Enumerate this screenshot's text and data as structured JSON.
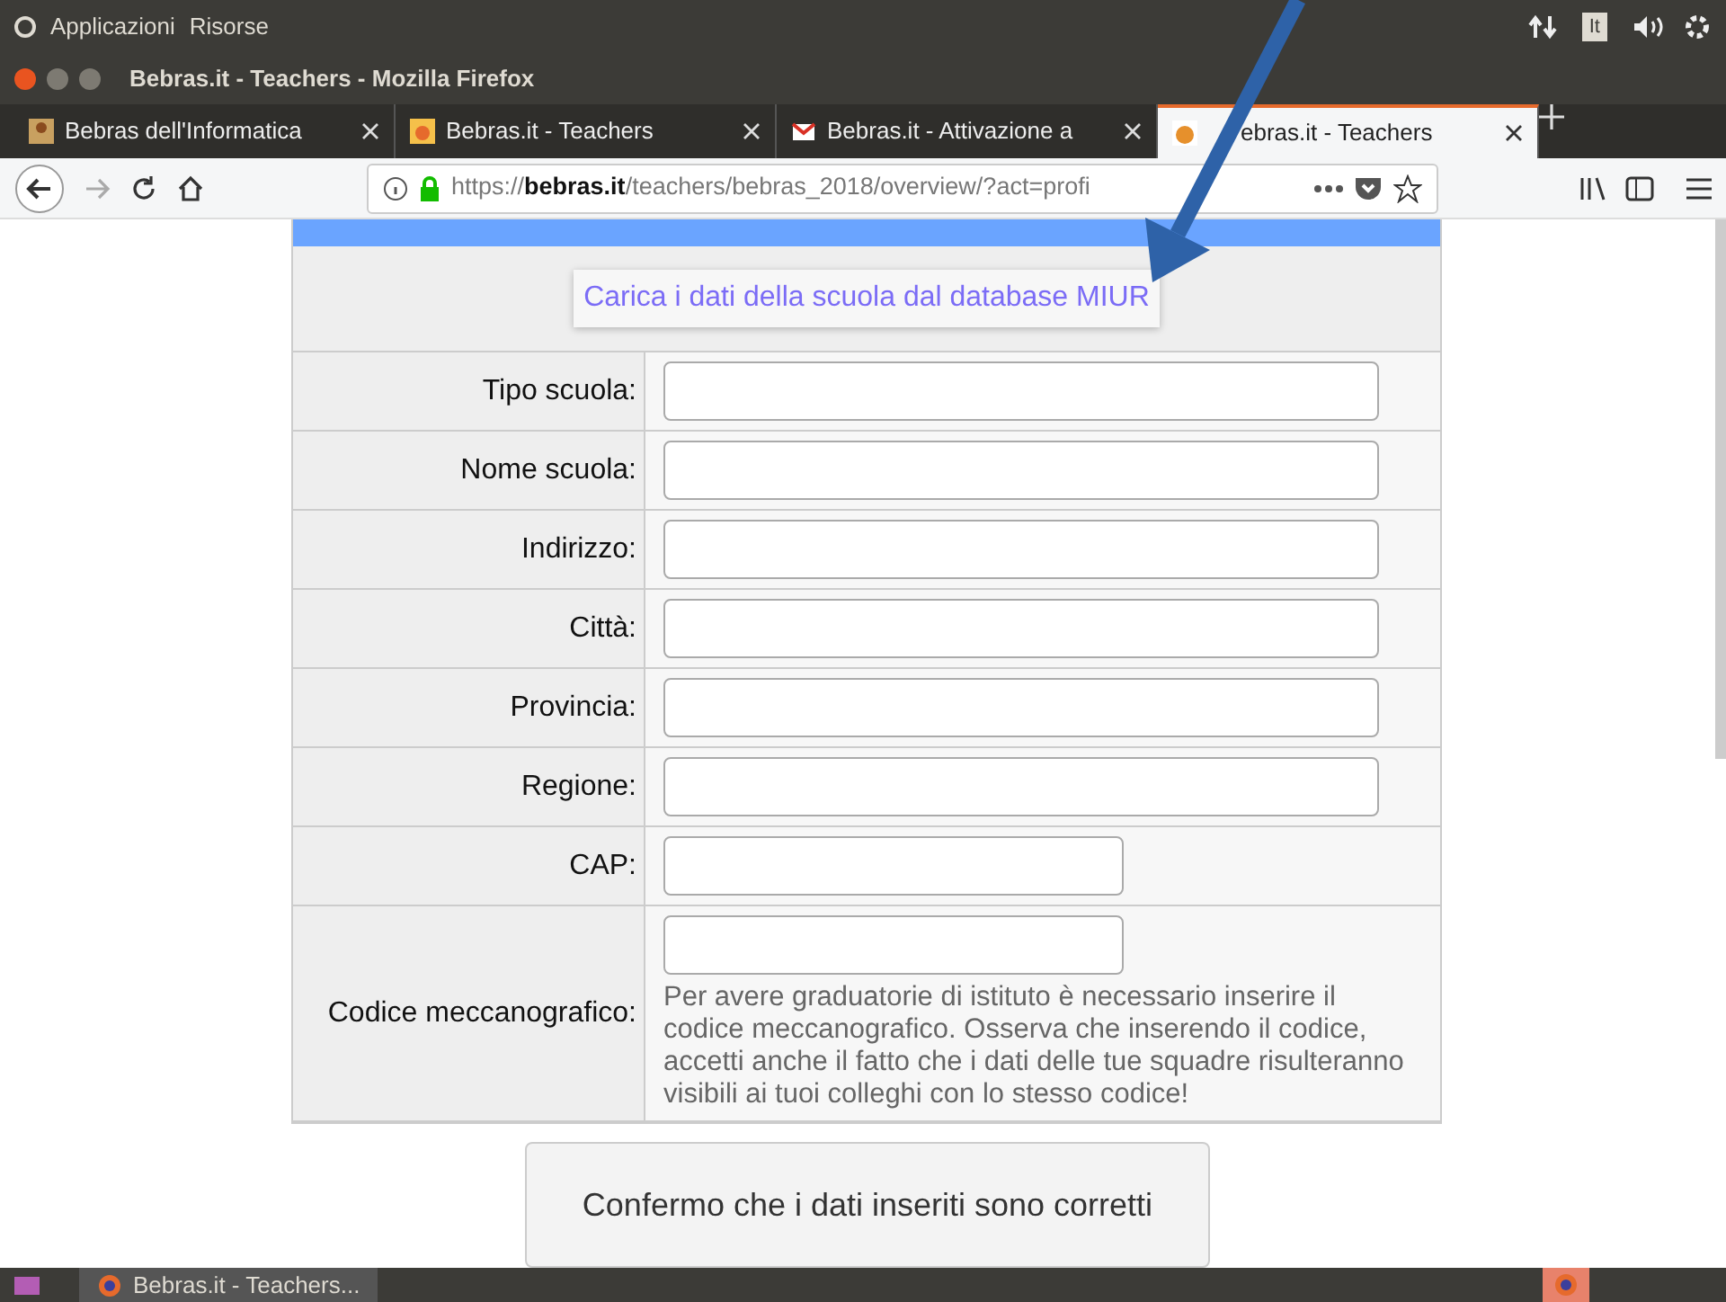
{
  "top_bar": {
    "menus": [
      "Applicazioni",
      "Risorse"
    ],
    "keyboard": "It"
  },
  "window": {
    "title": "Bebras.it - Teachers - Mozilla Firefox"
  },
  "tabs": [
    {
      "label": "Bebras dell'Informatica",
      "selected": false
    },
    {
      "label": "Bebras.it - Teachers",
      "selected": false
    },
    {
      "label": "Bebras.it - Attivazione a",
      "selected": false
    },
    {
      "label": "ebras.it - Teachers",
      "selected": true
    }
  ],
  "url": {
    "scheme": "https://",
    "host": "bebras.it",
    "path": "/teachers/bebras_2018/overview/?act=profi"
  },
  "load_button": "Carica i dati della scuola dal database MIUR",
  "fields": [
    {
      "label": "Tipo scuola:",
      "kind": "wide"
    },
    {
      "label": "Nome scuola:",
      "kind": "wide"
    },
    {
      "label": "Indirizzo:",
      "kind": "wide"
    },
    {
      "label": "Città:",
      "kind": "wide"
    },
    {
      "label": "Provincia:",
      "kind": "wide"
    },
    {
      "label": "Regione:",
      "kind": "wide"
    },
    {
      "label": "CAP:",
      "kind": "narrow"
    },
    {
      "label": "Codice meccanografico:",
      "kind": "narrow",
      "help": "Per avere graduatorie di istituto è necessario inserire il codice meccanografico. Osserva che inserendo il codice, accetti anche il fatto che i dati delle tue squadre risulteranno visibili ai tuoi colleghi con lo stesso codice!"
    }
  ],
  "confirm_button": "Confermo che i dati inseriti sono corretti",
  "taskbar": {
    "window": "Bebras.it - Teachers..."
  }
}
